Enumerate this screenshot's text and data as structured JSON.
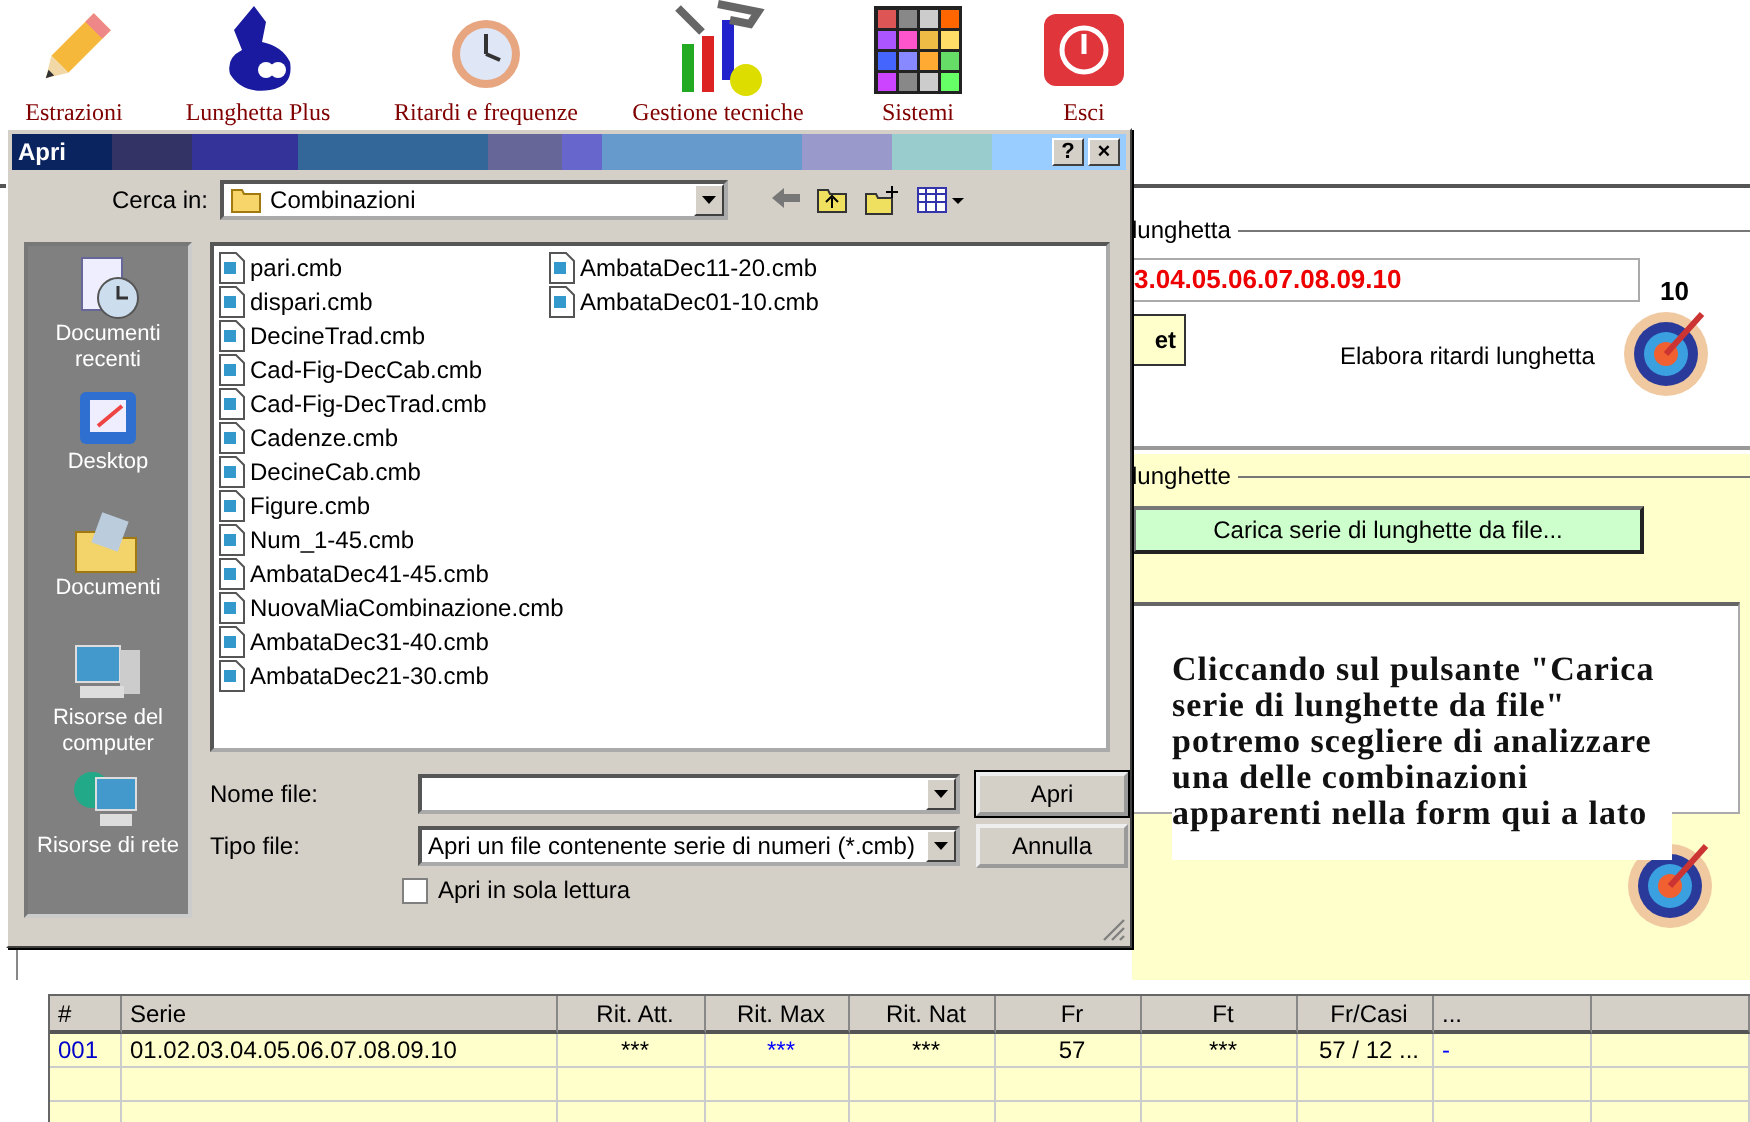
{
  "toolbar": [
    {
      "label": "Estrazioni"
    },
    {
      "label": "Lunghetta Plus"
    },
    {
      "label": "Ritardi e frequenze"
    },
    {
      "label": "Gestione tecniche"
    },
    {
      "label": "Sistemi"
    },
    {
      "label": "Esci"
    }
  ],
  "lunghetta": {
    "legend": "lunghetta",
    "value": "3.04.05.06.07.08.09.10",
    "count": "10",
    "button": "et",
    "action": "Elabora ritardi lunghetta"
  },
  "serie": {
    "legend": "lunghette",
    "load_button": "Carica serie di lunghette da file..."
  },
  "note": "Cliccando sul pulsante \"Carica serie di lunghette da file\" potremo scegliere di analizzare una delle combinazioni apparenti nella form qui a lato",
  "table": {
    "columns": [
      "#",
      "Serie",
      "Rit. Att.",
      "Rit. Max",
      "Rit. Nat",
      "Fr",
      "Ft",
      "Fr/Casi",
      "..."
    ],
    "rows": [
      [
        {
          "text": "001",
          "color": "#0000cc"
        },
        {
          "text": "01.02.03.04.05.06.07.08.09.10",
          "color": "#000000"
        },
        {
          "text": "***",
          "color": "#000000"
        },
        {
          "text": "***",
          "color": "#0000ff"
        },
        {
          "text": "***",
          "color": "#000000"
        },
        {
          "text": "57",
          "color": "#000000"
        },
        {
          "text": "***",
          "color": "#000000"
        },
        {
          "text": "57 / 12 ...",
          "color": "#000000"
        },
        {
          "text": "-",
          "color": "#0000ff"
        }
      ]
    ]
  },
  "dialog": {
    "title": "Apri",
    "help_button": "?",
    "close_button": "×",
    "look_in_label": "Cerca in:",
    "look_in": "Combinazioni",
    "places": [
      {
        "label": "Documenti recenti"
      },
      {
        "label": "Desktop"
      },
      {
        "label": "Documenti"
      },
      {
        "label": "Risorse del computer"
      },
      {
        "label": "Risorse di rete"
      }
    ],
    "files": [
      {
        "name": "pari.cmb"
      },
      {
        "name": "dispari.cmb"
      },
      {
        "name": "DecineTrad.cmb"
      },
      {
        "name": "Cad-Fig-DecCab.cmb"
      },
      {
        "name": "Cad-Fig-DecTrad.cmb"
      },
      {
        "name": "Cadenze.cmb"
      },
      {
        "name": "DecineCab.cmb"
      },
      {
        "name": "Figure.cmb"
      },
      {
        "name": "Num_1-45.cmb"
      },
      {
        "name": "AmbataDec41-45.cmb"
      },
      {
        "name": "NuovaMiaCombinazione.cmb"
      },
      {
        "name": "AmbataDec31-40.cmb"
      },
      {
        "name": "AmbataDec21-30.cmb"
      },
      {
        "name": "AmbataDec11-20.cmb"
      },
      {
        "name": "AmbataDec01-10.cmb"
      }
    ],
    "file_name_label": "Nome file:",
    "file_type_label": "Tipo file:",
    "file_type": "Apri un file contenente serie di numeri (*.cmb)",
    "open_button": "Apri",
    "cancel_button": "Annulla",
    "read_only": {
      "label": "Apri in sola lettura",
      "checked": false
    }
  }
}
